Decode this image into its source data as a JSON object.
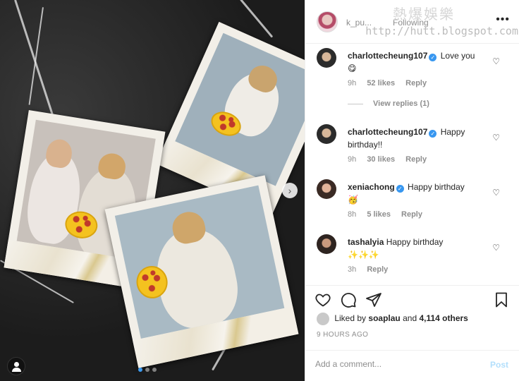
{
  "watermark": {
    "title": "熱爆娛樂",
    "url": "http://hutt.blogspot.com"
  },
  "post": {
    "username": "k_pu...",
    "follow_label": "Following",
    "more_label": "•••"
  },
  "comments": [
    {
      "user": "charlottecheung107",
      "verified": true,
      "text": "Love you",
      "emoji": "😋",
      "age": "9h",
      "likes": "52 likes",
      "reply": "Reply"
    },
    {
      "user": "charlottecheung107",
      "verified": true,
      "text": "Happy birthday!!",
      "emoji": "",
      "age": "9h",
      "likes": "30 likes",
      "reply": "Reply"
    },
    {
      "user": "xeniachong",
      "verified": true,
      "text": "Happy birthday",
      "emoji": "🥳",
      "age": "8h",
      "likes": "5 likes",
      "reply": "Reply"
    },
    {
      "user": "tashalyia",
      "verified": false,
      "text": "Happy birthday",
      "emoji": "✨✨✨",
      "age": "3h",
      "likes": "",
      "reply": "Reply"
    }
  ],
  "view_replies": "View replies (1)",
  "liked_by": {
    "prefix": "Liked by",
    "user": "soaplau",
    "and": "and",
    "others": "4,114 others"
  },
  "timestamp": "9 HOURS AGO",
  "add_comment": {
    "placeholder": "Add a comment...",
    "post_label": "Post"
  },
  "icons": {
    "heart": "heart-icon",
    "comment": "comment-icon",
    "share": "paper-plane-icon",
    "save": "bookmark-icon",
    "next": "chevron-right-icon",
    "tagged_user": "user-icon"
  },
  "colors": {
    "link": "#3897f0",
    "muted": "#8e8e8e",
    "post_disabled": "#b2dffc"
  }
}
